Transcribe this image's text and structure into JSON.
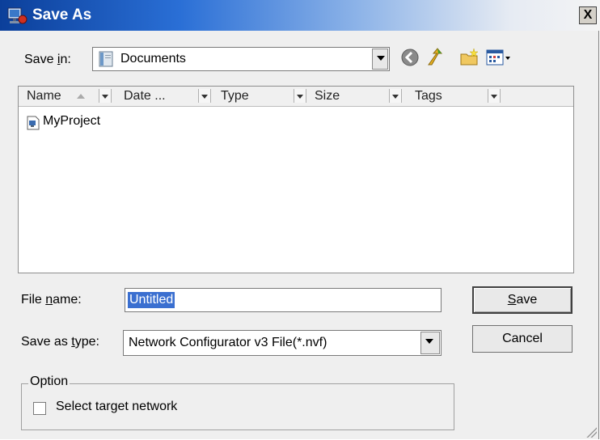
{
  "window": {
    "title": "Save As",
    "close_label": "X"
  },
  "save_in": {
    "label_prefix": "Save ",
    "label_accel": "i",
    "label_suffix": "n:",
    "value": "Documents"
  },
  "columns": [
    {
      "label": "Name"
    },
    {
      "label": "Date ..."
    },
    {
      "label": "Type"
    },
    {
      "label": "Size"
    },
    {
      "label": "Tags"
    }
  ],
  "files": [
    {
      "name": "MyProject"
    }
  ],
  "file_name": {
    "label_prefix": "File ",
    "label_accel": "n",
    "label_suffix": "ame:",
    "value": "Untitled"
  },
  "save_as_type": {
    "label_prefix": "Save as ",
    "label_accel": "t",
    "label_suffix": "ype:",
    "value": "Network Configurator v3 File(*.nvf)"
  },
  "buttons": {
    "save_accel": "S",
    "save_rest": "ave",
    "cancel": "Cancel"
  },
  "option_group": {
    "title": "Option",
    "checkbox_label": "Select target network",
    "checked": false
  },
  "colors": {
    "title_start": "#0b3f9a",
    "selection": "#3a6fd0",
    "face": "#efefef"
  }
}
